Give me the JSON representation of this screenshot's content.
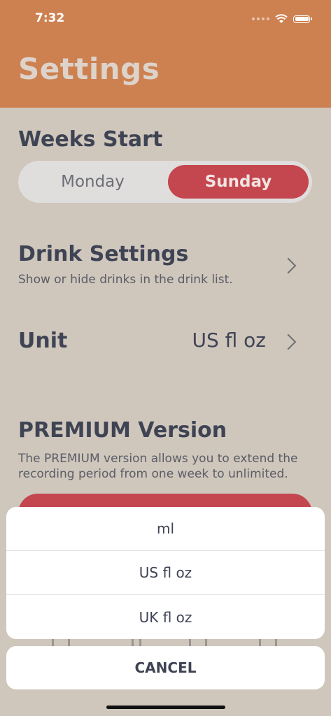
{
  "status_bar": {
    "time": "7:32"
  },
  "header": {
    "title": "Settings"
  },
  "weeks_start": {
    "title": "Weeks Start",
    "options": [
      "Monday",
      "Sunday"
    ],
    "selected": "Sunday"
  },
  "drink_settings": {
    "title": "Drink Settings",
    "subtitle": "Show or hide drinks in the drink list."
  },
  "unit": {
    "title": "Unit",
    "value": "US fl oz"
  },
  "premium": {
    "title": "PREMIUM Version",
    "description": "The PREMIUM version allows you to extend the recording period from one week to unlimited."
  },
  "action_sheet": {
    "options": [
      "ml",
      "US fl oz",
      "UK fl oz"
    ],
    "cancel_label": "CANCEL"
  },
  "colors": {
    "header": "#cd8150",
    "background": "#cfc6bc",
    "accent_red": "#c4464e",
    "text_dark": "#3f4454"
  }
}
